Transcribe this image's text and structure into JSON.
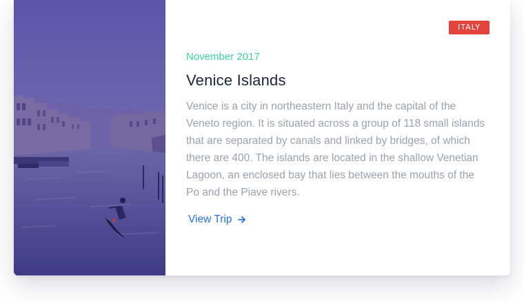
{
  "card": {
    "badge": "ITALY",
    "date": "November 2017",
    "title": "Venice Islands",
    "description": "Venice is a city in northeastern Italy and the capital of the Veneto region. It is situated across a group of 118 small islands that are separated by canals and linked by bridges, of which there are 400. The islands are located in the shallow Venetian Lagoon, an enclosed bay that lies between the mouths of the Po and the Piave rivers.",
    "link_label": "View Trip",
    "link_icon": "arrow-right-icon",
    "photo_subject": "venice-canal-gondola-photo"
  },
  "colors": {
    "badge": "#e3433b",
    "date": "#3fd0a0",
    "title": "#1f2333",
    "description": "#9ea0ae",
    "link": "#2a72d8",
    "photo_overlay": "#3d3d8c"
  }
}
